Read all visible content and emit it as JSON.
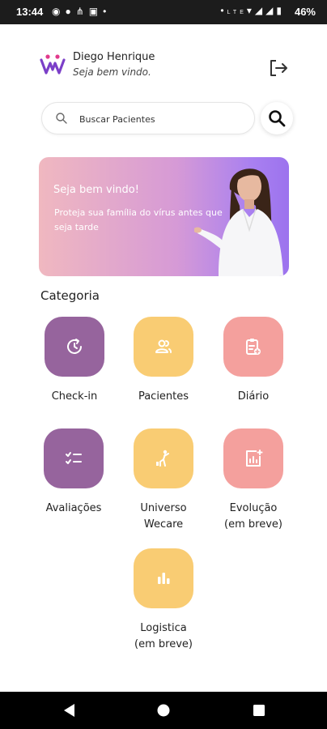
{
  "status_bar": {
    "time": "13:44",
    "left_icons": [
      "whatsapp-icon",
      "chat-bubble-icon",
      "network-icon",
      "app-icon",
      "dot-icon"
    ],
    "right_icons": [
      "dot-icon",
      "volte-icon",
      "wifi-icon",
      "signal-4g-icon",
      "signal-icon",
      "battery-icon"
    ],
    "battery": "46%"
  },
  "header": {
    "user_name": "Diego Henrique",
    "welcome": "Seja bem vindo.",
    "brand_color": "#7b3fc8"
  },
  "search": {
    "placeholder": "Buscar Pacientes"
  },
  "banner": {
    "title": "Seja bem vindo!",
    "text": "Proteja sua família do vírus antes que seja tarde"
  },
  "categories_title": "Categoria",
  "categories": [
    {
      "label": "Check-in",
      "icon": "check-in-clock-icon",
      "color": "#96649d"
    },
    {
      "label": "Pacientes",
      "icon": "patients-icon",
      "color": "#f9cc73"
    },
    {
      "label": "Diário",
      "icon": "diary-clipboard-icon",
      "color": "#f4a09d"
    },
    {
      "label": "Avaliações",
      "icon": "checklist-icon",
      "color": "#96649d"
    },
    {
      "label": "Universo\nWecare",
      "icon": "universe-icon",
      "color": "#f9cc73"
    },
    {
      "label": "Evolução\n(em breve)",
      "icon": "evolution-chart-icon",
      "color": "#f4a09d"
    },
    {
      "label": "Logistica\n(em breve)",
      "icon": "logistics-chart-icon",
      "color": "#f9cc73"
    }
  ],
  "nav": [
    "back-icon",
    "home-icon",
    "recents-icon"
  ]
}
